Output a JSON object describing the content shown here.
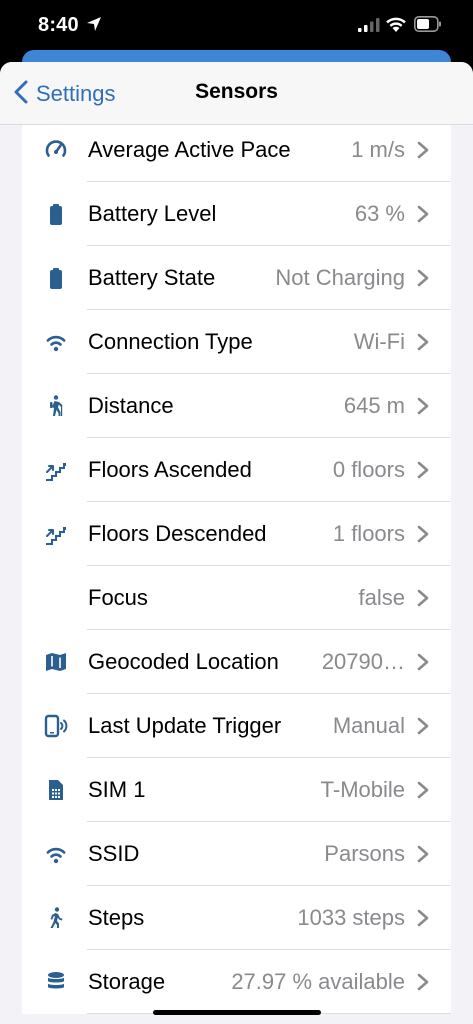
{
  "status_bar": {
    "time": "8:40"
  },
  "nav": {
    "back_label": "Settings",
    "title": "Sensors"
  },
  "rows": [
    {
      "label": "Average Active Pace",
      "value": "1 m/s",
      "icon": "speedometer-icon"
    },
    {
      "label": "Battery Level",
      "value": "63 %",
      "icon": "battery-icon"
    },
    {
      "label": "Battery State",
      "value": "Not Charging",
      "icon": "battery-icon"
    },
    {
      "label": "Connection Type",
      "value": "Wi-Fi",
      "icon": "wifi-icon"
    },
    {
      "label": "Distance",
      "value": "645 m",
      "icon": "hiking-icon"
    },
    {
      "label": "Floors Ascended",
      "value": "0 floors",
      "icon": "stairs-icon"
    },
    {
      "label": "Floors Descended",
      "value": "1 floors",
      "icon": "stairs-icon"
    },
    {
      "label": "Focus",
      "value": "false",
      "icon": "moon-icon"
    },
    {
      "label": "Geocoded Location",
      "value": "20790…",
      "icon": "map-icon"
    },
    {
      "label": "Last Update Trigger",
      "value": "Manual",
      "icon": "cellphone-wireless-icon"
    },
    {
      "label": "SIM 1",
      "value": "T-Mobile",
      "icon": "sim-card-icon"
    },
    {
      "label": "SSID",
      "value": "Parsons",
      "icon": "wifi-icon"
    },
    {
      "label": "Steps",
      "value": "1033 steps",
      "icon": "walking-icon"
    },
    {
      "label": "Storage",
      "value": "27.97 % available",
      "icon": "database-icon"
    }
  ]
}
